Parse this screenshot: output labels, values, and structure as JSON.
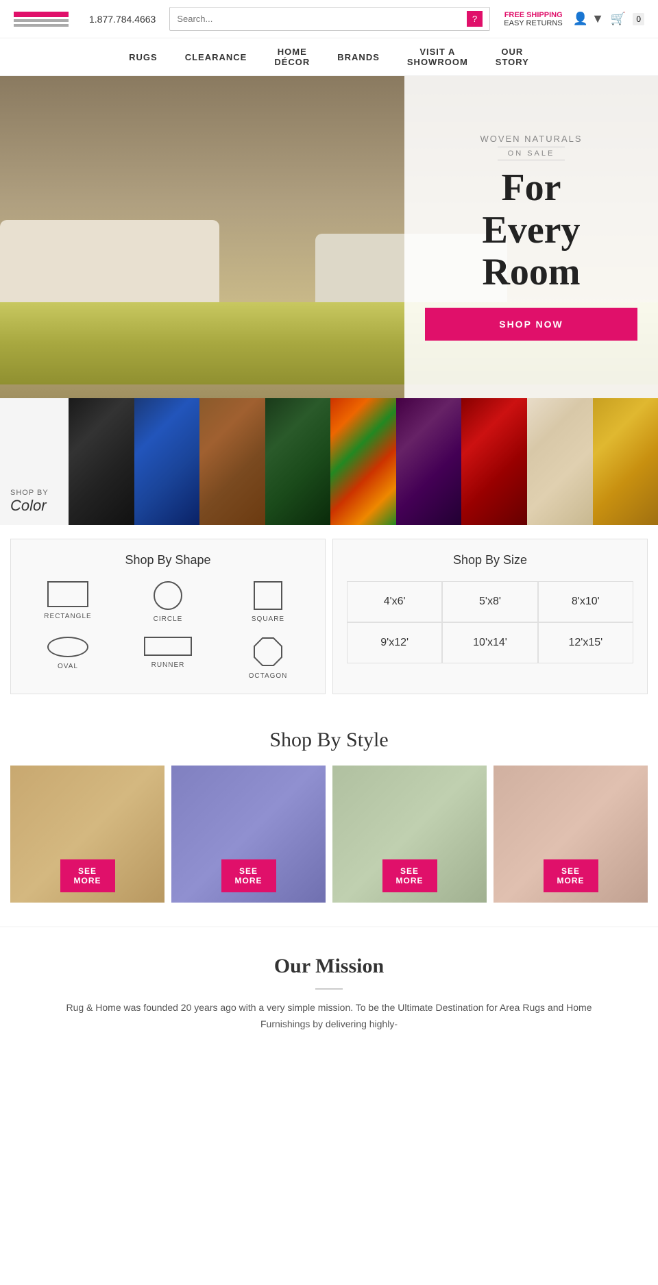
{
  "header": {
    "phone": "1.877.784.4663",
    "search_placeholder": "Search...",
    "free_shipping": "FREE SHIPPING",
    "easy_returns": "EASY RETURNS",
    "cart_count": "0"
  },
  "nav": {
    "items": [
      {
        "label": "RUGS"
      },
      {
        "label": "CLEARANCE"
      },
      {
        "label": "HOME\nDÉCOR"
      },
      {
        "label": "BRANDS"
      },
      {
        "label": "VISIT A\nSHOWROOM"
      },
      {
        "label": "OUR\nSTORY"
      }
    ]
  },
  "hero": {
    "subtitle": "Woven Naturals",
    "on_sale": "ON SALE",
    "title_line1": "For",
    "title_line2": "Every",
    "title_line3": "Room",
    "shop_now": "SHOP NOW"
  },
  "color_strip": {
    "shop_by": "SHOP BY",
    "label": "Color",
    "swatches": [
      {
        "name": "Black"
      },
      {
        "name": "Blue"
      },
      {
        "name": "Brown"
      },
      {
        "name": "Dark Green"
      },
      {
        "name": "Multi"
      },
      {
        "name": "Purple"
      },
      {
        "name": "Red"
      },
      {
        "name": "Beige"
      },
      {
        "name": "Gold"
      }
    ]
  },
  "shop_shape": {
    "title": "Shop By Shape",
    "shapes": [
      {
        "label": "RECTANGLE"
      },
      {
        "label": "CIRCLE"
      },
      {
        "label": "SQUARE"
      },
      {
        "label": "OVAL"
      },
      {
        "label": "RUNNER"
      },
      {
        "label": "OCTAGON"
      }
    ]
  },
  "shop_size": {
    "title": "Shop By Size",
    "sizes": [
      {
        "label": "4'x6'"
      },
      {
        "label": "5'x8'"
      },
      {
        "label": "8'x10'"
      },
      {
        "label": "9'x12'"
      },
      {
        "label": "10'x14'"
      },
      {
        "label": "12'x15'"
      }
    ]
  },
  "shop_style": {
    "title": "Shop By Style",
    "cards": [
      {
        "see_more": "SEE\nMORE"
      },
      {
        "see_more": "SEE\nMORE"
      },
      {
        "see_more": "SEE\nMORE"
      },
      {
        "see_more": "SEE\nMORE"
      }
    ]
  },
  "mission": {
    "title": "Our Mission",
    "text": "Rug & Home was founded 20 years ago with a very simple mission. To be the Ultimate Destination for Area Rugs and Home Furnishings by delivering highly-"
  }
}
